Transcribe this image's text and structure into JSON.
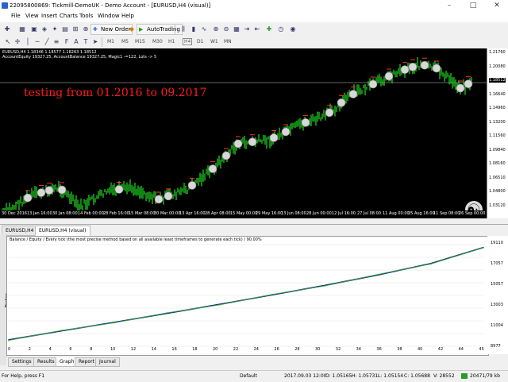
{
  "window": {
    "title": "22095800869: Tickmill-DemoUK - Demo Account - [EURUSD,H4 (visual)]",
    "controls": [
      "–",
      "□",
      "✕"
    ]
  },
  "menu": [
    "File",
    "View",
    "Insert",
    "Charts",
    "Tools",
    "Window",
    "Help"
  ],
  "toolbar": {
    "new_order": "New Order",
    "auto_trading": "AutoTrading",
    "timeframes": [
      "M1",
      "M5",
      "M15",
      "M30",
      "H1",
      "H4",
      "D1",
      "W1",
      "MN"
    ]
  },
  "chart": {
    "symbol_line": "EURUSD,H4  1.18346 1.18577 1.18263 1.18512",
    "info_line": "AccountEquity 19327.25, AccountBalance 19327.25, Magic1 -=122, Lots -> 5",
    "overlay_text": "testing from 01.2016 to 09.2017",
    "price_labels": [
      "1.21760",
      "1.20080",
      "1.18512",
      "1.16640",
      "1.14960",
      "1.13200",
      "1.11560",
      "1.09840",
      "1.08160",
      "1.06510",
      "1.04800",
      "1.03120"
    ],
    "current_price": "1.18512",
    "time_labels": [
      "30 Dec 2016",
      "13 Jan 16:00",
      "30 Jan 08:00",
      "14 Feb 00:00",
      "28 Feb 16:00",
      "15 Mar 08:00",
      "30 Mar 00:00",
      "13 Apr 16:00",
      "28 Apr 08:00",
      "15 May 00:00",
      "29 May 16:00",
      "13 Jun 08:00",
      "28 Jun 00:00",
      "12 Jul 16:00",
      "27 Jul 08:00",
      "11 Aug 00:00",
      "25 Aug 16:00",
      "11 Sep 08:00",
      "26 Sep 00:00"
    ],
    "candle_color": "#22dd22",
    "background": "#000000"
  },
  "chart_tabs": [
    "EURUSD,H4",
    "EURUSD,H4 (visual)"
  ],
  "tester": {
    "side_label": "Tester",
    "legend": "Balance / Equity / Every tick (the most precise method based on all available least timeframes to generate each tick) / 90.00%",
    "y_labels": [
      "19110",
      "17057",
      "15057",
      "13003",
      "11004",
      "8977"
    ],
    "x_labels": [
      "0",
      "2",
      "4",
      "6",
      "8",
      "10",
      "12",
      "14",
      "16",
      "18",
      "20",
      "22",
      "24",
      "26",
      "28",
      "30",
      "32",
      "34",
      "36",
      "38",
      "40",
      "42",
      "44",
      "45"
    ],
    "tabs": [
      "Settings",
      "Results",
      "Graph",
      "Report",
      "Journal"
    ],
    "active_tab": "Graph",
    "balance_color": "#1a1a8c",
    "equity_color": "#2fae2f"
  },
  "chart_data": {
    "type": "line",
    "title": "",
    "xlabel": "",
    "ylabel": "",
    "x": [
      0,
      5,
      10,
      15,
      20,
      25,
      30,
      35,
      40,
      45
    ],
    "ylim": [
      8977,
      19700
    ],
    "series": [
      {
        "name": "Balance",
        "values": [
          9650,
          10600,
          11500,
          12450,
          13400,
          14400,
          15400,
          16500,
          17700,
          19400
        ]
      },
      {
        "name": "Equity",
        "values": [
          9600,
          10650,
          11450,
          12500,
          13350,
          14450,
          15350,
          16550,
          17650,
          19380
        ]
      }
    ]
  },
  "status": {
    "help": "For Help, press F1",
    "profile": "Default",
    "datetime": "2017.09.03 12:00",
    "open": "O: 1.05165",
    "high": "H: 1.05731",
    "low": "L: 1.05154",
    "close": "C: 1.05688",
    "volume": "V: 28552",
    "traffic": "20471/79 kb"
  }
}
